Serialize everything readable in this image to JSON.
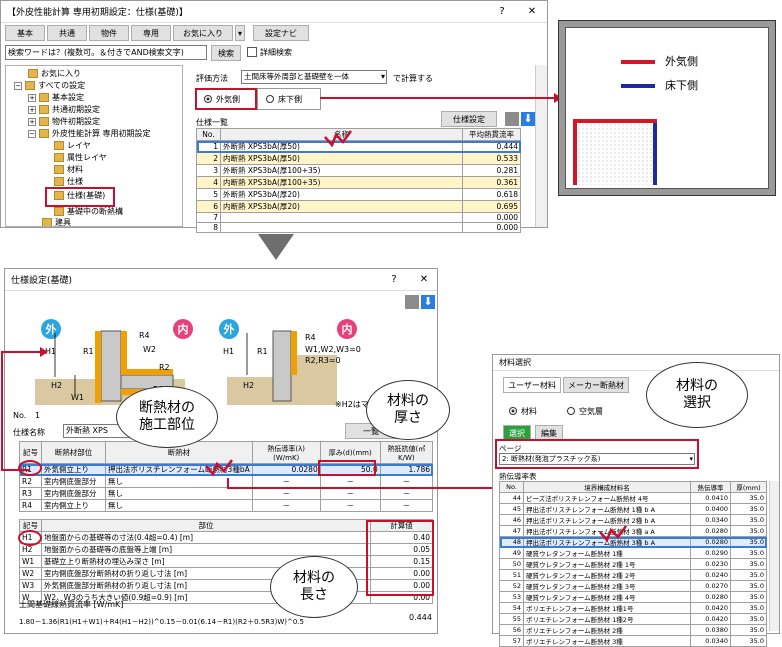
{
  "top_window": {
    "title": "【外皮性能計算 専用初期設定：仕様(基礎)】",
    "help": "?",
    "close": "✕",
    "toolbar": [
      "基本",
      "共通",
      "物件",
      "専用",
      "お気に入り",
      "設定ナビ"
    ],
    "search_placeholder": "検索ワードは？(複数可。＆付きでAND検索文字)",
    "search_btn": "検索",
    "detail_search": "詳細検索",
    "tree": [
      "お気に入り",
      "すべての設定",
      "基本設定",
      "共通初期設定",
      "物件初期設定",
      "外皮性能計算 専用初期設定",
      "レイヤ",
      "属性レイヤ",
      "材料",
      "仕様",
      "仕様(基礎)",
      "基礎中の断熱構",
      "建具"
    ],
    "eval_label": "評価方法",
    "eval_value": "土間床等外周部と基礎壁を一体",
    "eval_suffix": "で計算する",
    "radio_outside": "外気側",
    "radio_floor": "床下側",
    "list_title": "仕様一覧",
    "spec_btn": "仕様設定",
    "cols": [
      "No.",
      "名称",
      "平均熱貫流率"
    ],
    "rows": [
      [
        "1",
        "外断熱 XPS3bA(厚50)",
        "0.444"
      ],
      [
        "2",
        "内断熱 XPS3bA(厚50)",
        "0.533"
      ],
      [
        "3",
        "外断熱 XPS3bA(厚100+35)",
        "0.281"
      ],
      [
        "4",
        "内断熱 XPS3bA(厚100+35)",
        "0.361"
      ],
      [
        "5",
        "外断熱 XPS3bA(厚20)",
        "0.618"
      ],
      [
        "6",
        "内断熱 XPS3bA(厚20)",
        "0.695"
      ],
      [
        "7",
        "",
        "0.000"
      ],
      [
        "8",
        "",
        "0.000"
      ]
    ]
  },
  "legend": {
    "outside": "外気側",
    "floor": "床下側"
  },
  "spec_window": {
    "title": "仕様設定(基礎)",
    "help": "?",
    "close": "✕",
    "badge_out": "外",
    "badge_in": "内",
    "d1": {
      "h1": "H1",
      "r1": "R1",
      "r4": "R4",
      "w2": "W2",
      "r2": "R2",
      "r3": "R3",
      "h2": "H2",
      "w1": "W1"
    },
    "d2": {
      "h1": "H1",
      "r1": "R1",
      "r4": "R4",
      "w": "W1,W2,W3=0",
      "r": "R2,R3=0",
      "h2": "H2"
    },
    "note": "※H2はマ",
    "no_label": "No.",
    "no_value": "1",
    "name_label": "仕様名称",
    "name_value": "外断熱 XPS",
    "list_btn": "一覧",
    "head": [
      "記号",
      "断熱材部位",
      "断熱材",
      "熱伝導率(λ)(W/mK)",
      "厚み(d)(mm)",
      "熱抵抗値(㎡K/W)"
    ],
    "rows": [
      [
        "R1",
        "外気側立上り",
        "押出法ポリスチレンフォーム断熱材3種bA",
        "0.0280",
        "50.0",
        "1.786"
      ],
      [
        "R2",
        "室内側底盤部分",
        "無し",
        "－",
        "－",
        "－"
      ],
      [
        "R3",
        "室内側底盤部分",
        "無し",
        "－",
        "－",
        "－"
      ],
      [
        "R4",
        "室内側立上り",
        "無し",
        "－",
        "－",
        "－"
      ]
    ],
    "head2": [
      "記号",
      "部位",
      "計算値"
    ],
    "rows2": [
      [
        "H1",
        "地盤面からの基礎等の寸法(0.4超=0.4) [m]",
        "0.40"
      ],
      [
        "H2",
        "地盤面からの基礎等の底盤等上端 [m]",
        "0.05"
      ],
      [
        "W1",
        "基礎立上り断熱材の埋込み深さ [m]",
        "0.15"
      ],
      [
        "W2",
        "室内側底盤部分断熱材の折り返し寸法 [m]",
        "0.00"
      ],
      [
        "W3",
        "外気側底盤部分断熱材の折り返し寸法 [m]",
        "0.00"
      ],
      [
        "W",
        "W2、W3のうち大きい値(0.9超=0.9) [m]",
        "0.00"
      ]
    ],
    "u_label": "土間基礎線熱貫流率 [W/mK]",
    "formula": "1.80－1.36(R1(H1＋W1)＋R4(H1－H2))^0.15－0.01(6.14－R1)(R2＋0.5R3)W)^0.5",
    "u_value": "0.444"
  },
  "material_window": {
    "title": "材料選択",
    "tabs": [
      "ユーザー材料",
      "メーカー断熱材"
    ],
    "radio_material": "材料",
    "radio_air": "空気層",
    "select_btn": "選択",
    "edit_btn": "編集",
    "page_label": "ページ",
    "page_value": "2: 断熱材(発泡プラスチック系)",
    "table_title": "熱伝導率表",
    "cols": [
      "No.",
      "境界構成材料名",
      "熱伝導率",
      "厚(mm)"
    ],
    "rows": [
      [
        "44",
        "ビーズ法ポリスチレンフォーム断熱材 4号",
        "0.0410",
        "35.0"
      ],
      [
        "45",
        "押出法ポリスチレンフォーム断熱材 1種 b A",
        "0.0400",
        "35.0"
      ],
      [
        "46",
        "押出法ポリスチレンフォーム断熱材 2種 b A",
        "0.0340",
        "35.0"
      ],
      [
        "47",
        "押出法ポリスチレンフォーム断熱材 3種 a A",
        "0.0280",
        "35.0"
      ],
      [
        "48",
        "押出法ポリスチレンフォーム断熱材 3種 b A",
        "0.0280",
        "35.0"
      ],
      [
        "49",
        "硬質ウレタンフォーム断熱材 1種",
        "0.0290",
        "35.0"
      ],
      [
        "50",
        "硬質ウレタンフォーム断熱材 2種 1号",
        "0.0230",
        "35.0"
      ],
      [
        "51",
        "硬質ウレタンフォーム断熱材 2種 2号",
        "0.0240",
        "35.0"
      ],
      [
        "52",
        "硬質ウレタンフォーム断熱材 2種 3号",
        "0.0270",
        "35.0"
      ],
      [
        "53",
        "硬質ウレタンフォーム断熱材 2種 4号",
        "0.0280",
        "35.0"
      ],
      [
        "54",
        "ポリエチレンフォーム断熱材 1種1号",
        "0.0420",
        "35.0"
      ],
      [
        "55",
        "ポリエチレンフォーム断熱材 1種2号",
        "0.0420",
        "35.0"
      ],
      [
        "56",
        "ポリエチレンフォーム断熱材 2種",
        "0.0380",
        "35.0"
      ],
      [
        "57",
        "ポリエチレンフォーム断熱材 3種",
        "0.0340",
        "35.0"
      ]
    ]
  },
  "callouts": {
    "part": "断熱材の\n施工部位",
    "thick": "材料の\n厚さ",
    "select": "材料の\n選択",
    "length": "材料の\n長さ"
  },
  "colors": {
    "accent_red": "#c8102e",
    "outside": "#d3172a",
    "floor": "#1f2a9e",
    "badge_out": "#29a5e0",
    "badge_in": "#e8417a",
    "insul": "#f0a000"
  }
}
